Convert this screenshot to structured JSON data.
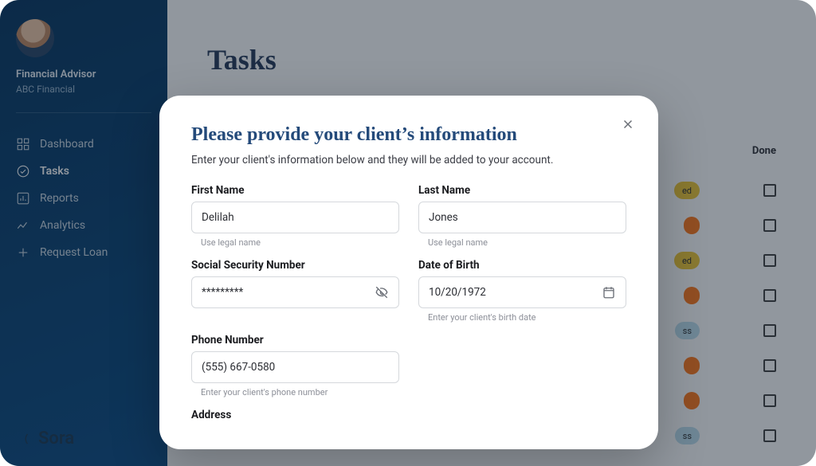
{
  "user": {
    "role": "Financial Advisor",
    "company": "ABC Financial"
  },
  "sidebar": {
    "items": [
      {
        "label": "Dashboard"
      },
      {
        "label": "Tasks"
      },
      {
        "label": "Reports"
      },
      {
        "label": "Analytics"
      },
      {
        "label": "Request Loan"
      }
    ]
  },
  "brand": {
    "name": "Sora"
  },
  "page": {
    "title": "Tasks"
  },
  "table": {
    "done_header": "Done",
    "rows": [
      {
        "chip": "ed",
        "chip_color": "yellow"
      },
      {
        "chip": "",
        "chip_color": "orange"
      },
      {
        "chip": "ed",
        "chip_color": "yellow"
      },
      {
        "chip": "",
        "chip_color": "orange"
      },
      {
        "chip": "ss",
        "chip_color": "blue"
      },
      {
        "chip": "",
        "chip_color": "orange"
      },
      {
        "chip": "",
        "chip_color": "orange"
      },
      {
        "chip": "ss",
        "chip_color": "blue"
      }
    ]
  },
  "modal": {
    "title": "Please provide your client’s information",
    "subtitle": "Enter your client's information below and they will be added to your account.",
    "fields": {
      "first_name": {
        "label": "First Name",
        "value": "Delilah",
        "helper": "Use legal name"
      },
      "last_name": {
        "label": "Last Name",
        "value": "Jones",
        "helper": "Use legal name"
      },
      "ssn": {
        "label": "Social Security Number",
        "value": "*********"
      },
      "dob": {
        "label": "Date of Birth",
        "value": "10/20/1972",
        "helper": "Enter your client's birth date"
      },
      "phone": {
        "label": "Phone Number",
        "value": "(555) 667-0580",
        "helper": "Enter your client's phone number"
      },
      "address": {
        "label": "Address"
      }
    }
  }
}
